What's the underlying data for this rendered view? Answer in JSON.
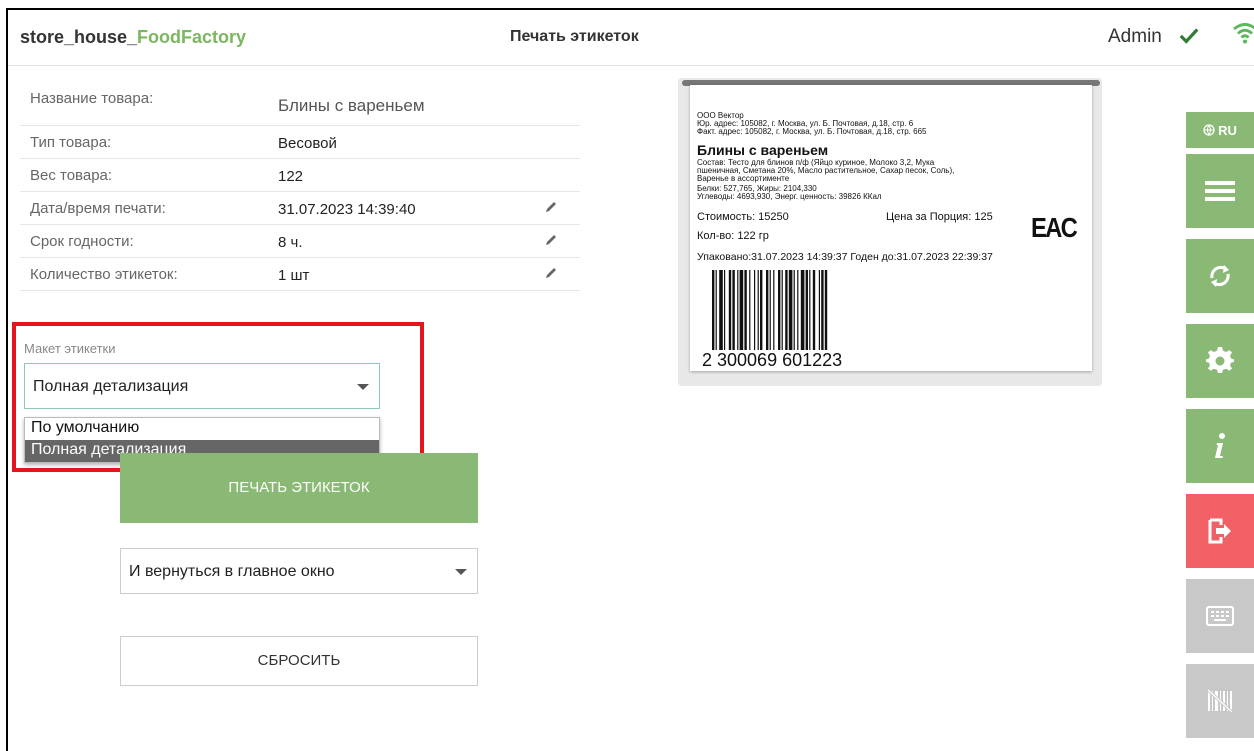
{
  "header": {
    "brand_prefix": "store_house_",
    "brand_suffix": "FoodFactory",
    "title": "Печать этикеток",
    "user": "Admin"
  },
  "fields": [
    {
      "label": "Название товара:",
      "value": "Блины с вареньем"
    },
    {
      "label": "Тип товара:",
      "value": "Весовой"
    },
    {
      "label": "Вес товара:",
      "value": "122"
    },
    {
      "label": "Дата/время печати:",
      "value": "31.07.2023 14:39:40"
    },
    {
      "label": "Срок годности:",
      "value": "8 ч."
    },
    {
      "label": "Количество этикеток:",
      "value": "1 шт"
    }
  ],
  "layout": {
    "label": "Макет этикетки",
    "selected": "Полная детализация",
    "options": [
      "По умолчанию",
      "Полная детализация"
    ]
  },
  "actions": {
    "print": "ПЕЧАТЬ ЭТИКЕТОК",
    "after_print": "И вернуться в главное окно",
    "reset": "СБРОСИТЬ"
  },
  "label_preview": {
    "company": "ООО Вектор",
    "legal_address": "Юр. адрес: 105082, г. Москва, ул. Б. Почтовая, д.18, стр. 6",
    "actual_address": "Факт. адрес: 105082, г. Москва, ул. Б. Почтовая, д.18, стр. 665",
    "product": "Блины с вареньем",
    "composition_1": "Состав: Тесто для блинов п/ф (Яйцо куриное, Молоко 3,2, Мука",
    "composition_2": "пшеничная, Сметана 20%, Масло растительное, Сахар песок, Соль),",
    "composition_3": "Варенье в ассортименте",
    "nutrition_1": "Белки: 527,765, Жиры: 2104,330",
    "nutrition_2": "Углеводы: 4693,930, Энерг. ценность: 39826 ККал",
    "cost": "Стоимость: 15250",
    "price_per_portion": "Цена за Порция: 125",
    "quantity": "Кол-во: 122 гр",
    "packed_expires": "Упаковано:31.07.2023 14:39:37  Годен до:31.07.2023 22:39:37",
    "eac": "EAC",
    "barcode_digits": "2 300069 601223"
  },
  "sidebar": {
    "lang": "RU",
    "colors": {
      "green": "#8ab976",
      "red": "#f06064",
      "gray": "#c8c8c8"
    }
  }
}
